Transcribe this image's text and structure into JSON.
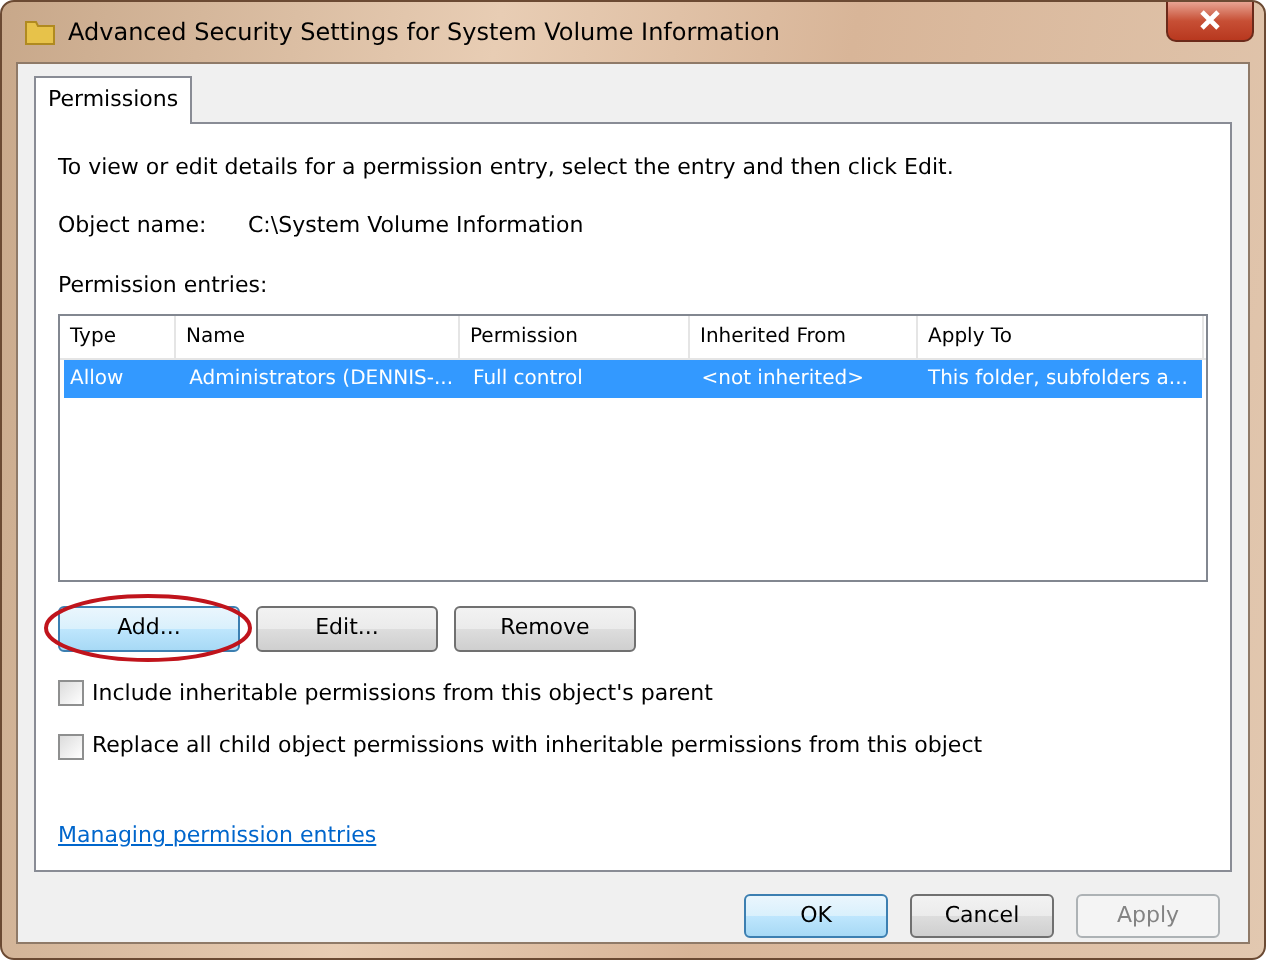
{
  "window": {
    "title": "Advanced Security Settings for System Volume Information"
  },
  "tabs": [
    {
      "label": "Permissions",
      "selected": true
    }
  ],
  "instructions": "To view or edit details for a permission entry, select the entry and then click Edit.",
  "object_name": {
    "label": "Object name:",
    "value": "C:\\System Volume Information"
  },
  "entries": {
    "label": "Permission entries:",
    "columns": [
      "Type",
      "Name",
      "Permission",
      "Inherited From",
      "Apply To"
    ],
    "rows": [
      {
        "cells": [
          "Allow",
          "Administrators (DENNIS-...",
          "Full control",
          "<not inherited>",
          "This folder, subfolders a..."
        ],
        "selected": true
      }
    ]
  },
  "entry_buttons": [
    {
      "label": "Add...",
      "focused": true,
      "highlighted": true,
      "disabled": false
    },
    {
      "label": "Edit...",
      "focused": false,
      "highlighted": false,
      "disabled": false
    },
    {
      "label": "Remove",
      "focused": false,
      "highlighted": false,
      "disabled": false
    }
  ],
  "checkboxes": [
    {
      "label": "Include inheritable permissions from this object's parent",
      "checked": false
    },
    {
      "label": "Replace all child object permissions with inheritable permissions from this object",
      "checked": false
    }
  ],
  "help_link": "Managing permission entries",
  "dialog_buttons": [
    {
      "label": "OK",
      "focused": true,
      "highlighted": false,
      "disabled": false
    },
    {
      "label": "Cancel",
      "focused": false,
      "highlighted": false,
      "disabled": false
    },
    {
      "label": "Apply",
      "focused": false,
      "highlighted": false,
      "disabled": true
    }
  ]
}
